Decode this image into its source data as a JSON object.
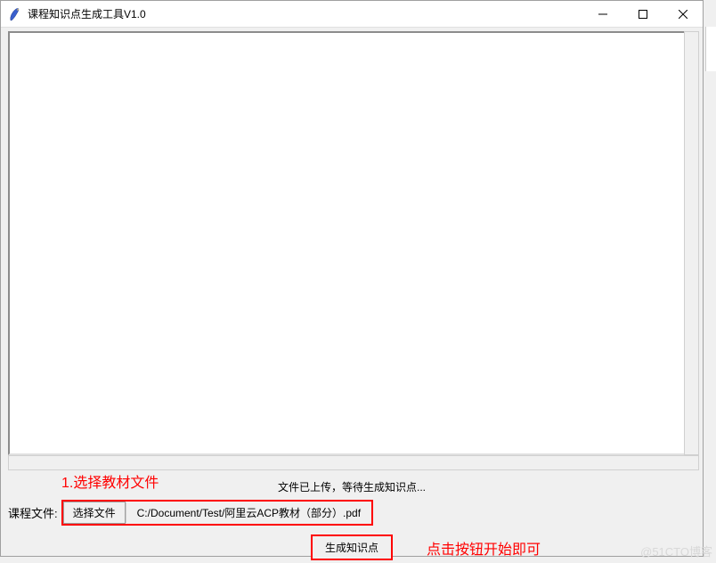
{
  "window": {
    "title": "课程知识点生成工具V1.0"
  },
  "status": {
    "message": "文件已上传，等待生成知识点..."
  },
  "file": {
    "label": "课程文件:",
    "choose_button": "选择文件",
    "path": "C:/Document/Test/阿里云ACP教材（部分）.pdf"
  },
  "actions": {
    "generate_button": "生成知识点"
  },
  "annotations": {
    "step1": "1.选择教材文件",
    "step2": "点击按钮开始即可"
  },
  "watermark": "@51CTO博客"
}
